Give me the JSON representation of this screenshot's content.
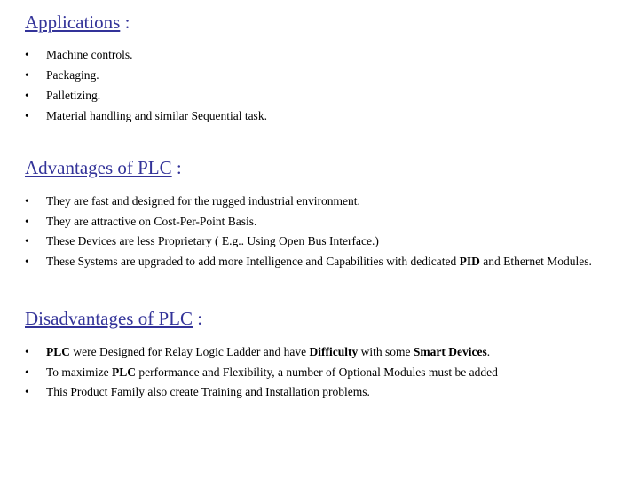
{
  "slide": {
    "background_color": "#ffffff",
    "heading_color": "#333399",
    "body_text_color": "#000000",
    "bullet_glyph": "•"
  },
  "sections": [
    {
      "id": "applications",
      "heading_main": "Applications",
      "heading_colon": " :",
      "bullets": [
        "Machine controls.",
        "Packaging.",
        "Palletizing.",
        "Material handling and similar Sequential task."
      ]
    },
    {
      "id": "advantages",
      "heading_main": "Advantages of PLC",
      "heading_colon": " :",
      "bullets": [
        "They are fast and designed for the rugged industrial environment.",
        "They are attractive on Cost-Per-Point Basis.",
        "These Devices are less Proprietary ( E.g.. Using Open Bus Interface.)",
        "These Systems are upgraded to add more Intelligence and Capabilities with dedicated PID and Ethernet Modules."
      ]
    },
    {
      "id": "disadvantages",
      "heading_main": "Disadvantages of PLC",
      "heading_colon": " :",
      "bullets": [
        "PLC were Designed for Relay Logic Ladder and have Difficulty with some Smart Devices.",
        "To maximize PLC performance and Flexibility, a number of Optional Modules  must be added",
        "This Product Family also create Training and Installation problems."
      ]
    }
  ]
}
